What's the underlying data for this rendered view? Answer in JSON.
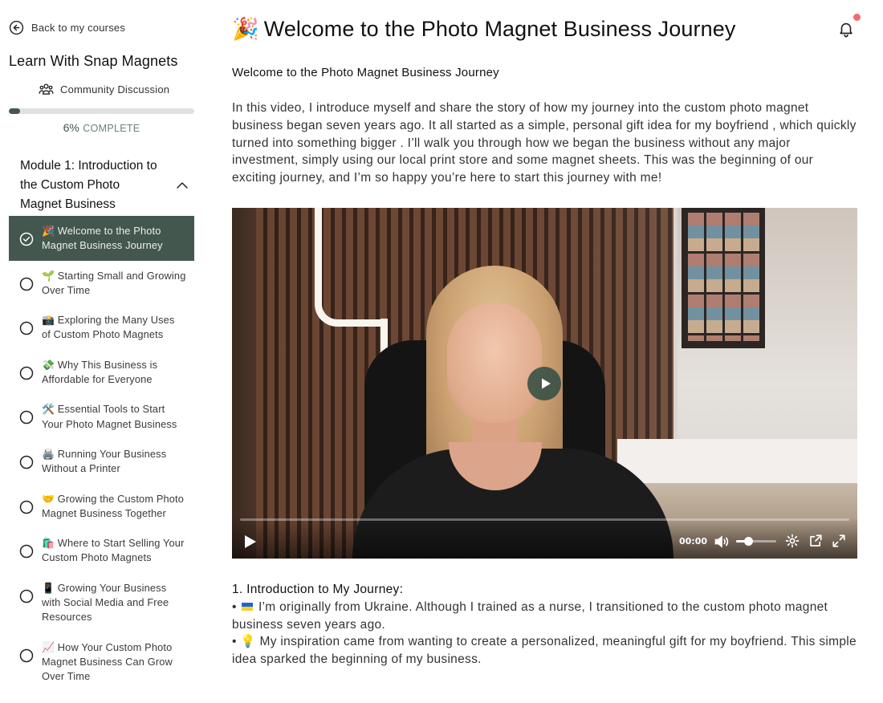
{
  "sidebar": {
    "back_label": "Back to my courses",
    "course_title": "Learn With Snap Magnets",
    "community_label": "Community Discussion",
    "progress": {
      "percent": 6,
      "percent_label": "6%",
      "complete_label": "COMPLETE"
    },
    "module": {
      "title": "Module 1: Introduction to the Custom Photo Magnet Business",
      "expanded": true
    },
    "lessons": [
      {
        "label": "🎉 Welcome to the Photo Magnet Business Journey",
        "completed": true,
        "active": true
      },
      {
        "label": "🌱 Starting Small and Growing Over Time",
        "completed": false,
        "active": false
      },
      {
        "label": "📸 Exploring the Many Uses of Custom Photo Magnets",
        "completed": false,
        "active": false
      },
      {
        "label": "💸 Why This Business is Affordable for Everyone",
        "completed": false,
        "active": false
      },
      {
        "label": "🛠️ Essential Tools to Start Your Photo Magnet Business",
        "completed": false,
        "active": false
      },
      {
        "label": "🖨️ Running Your Business Without a Printer",
        "completed": false,
        "active": false
      },
      {
        "label": "🤝 Growing the Custom Photo Magnet Business Together",
        "completed": false,
        "active": false
      },
      {
        "label": "🛍️ Where to Start Selling Your Custom Photo Magnets",
        "completed": false,
        "active": false
      },
      {
        "label": "📱 Growing Your Business with Social Media and Free Resources",
        "completed": false,
        "active": false
      },
      {
        "label": "📈 How Your Custom Photo Magnet Business Can Grow Over Time",
        "completed": false,
        "active": false
      }
    ]
  },
  "main": {
    "title_emoji": "🎉",
    "title": "Welcome to the Photo Magnet Business Journey",
    "subheading": "Welcome to the Photo Magnet Business Journey",
    "intro": "In this video, I introduce myself and share the story of how my journey into the custom photo magnet business began seven years ago. It all started as a simple, personal gift idea for my boyfriend , which quickly turned into something bigger . I’ll walk you through how we began the business without any major investment, simply using our local print store and some magnet sheets. This was the beginning of our exciting journey, and I’m so happy you’re here to start this journey with me!",
    "video": {
      "time": "00:00",
      "volume": 0.3
    },
    "section": {
      "title": "1. Introduction to My Journey:",
      "bullet1_prefix": "• ",
      "bullet1_text": " I’m originally from Ukraine. Although I trained as a nurse, I transitioned to the custom photo magnet business seven years ago.",
      "bullet2_prefix": "• 💡",
      "bullet2_text": " My inspiration came from wanting to create a personalized, meaningful gift for my boyfriend. This simple idea sparked the beginning of my business."
    }
  },
  "colors": {
    "accent": "#44574f",
    "notification_dot": "#f46a6a"
  },
  "icons": {
    "back": "arrow-left-circle-icon",
    "community": "users-icon",
    "collapse": "chevron-up-icon",
    "lesson_done": "check-circle-icon",
    "lesson_todo": "empty-circle-icon",
    "bell": "bell-icon",
    "play": "play-icon",
    "volume": "volume-icon",
    "settings": "gear-icon",
    "popout": "external-link-icon",
    "fullscreen": "fullscreen-icon"
  }
}
